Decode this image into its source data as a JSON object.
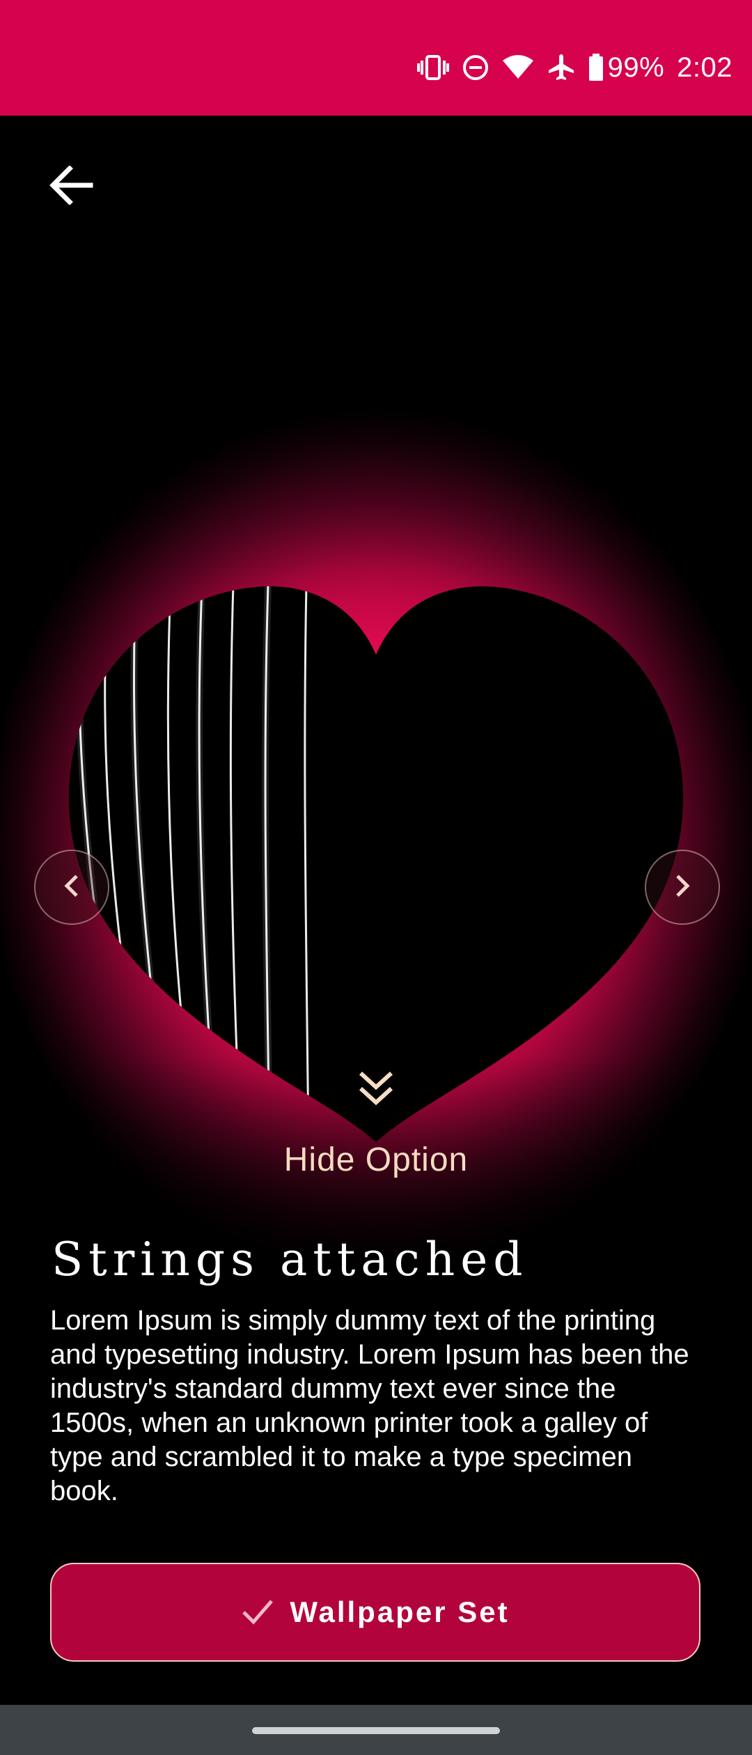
{
  "status_bar": {
    "battery_text": "99%",
    "time": "2:02",
    "background": "#d7024e",
    "icons": [
      "vibrate-icon",
      "do-not-disturb-icon",
      "wifi-icon",
      "airplane-mode-icon",
      "battery-icon"
    ]
  },
  "header": {
    "back_icon": "arrow-back-icon"
  },
  "preview": {
    "prev_icon": "chevron-left-icon",
    "next_icon": "chevron-right-icon",
    "hide_icon": "double-chevron-down-icon",
    "hide_label": "Hide Option",
    "glow_color": "#e3064f"
  },
  "content": {
    "title": "Strings attached",
    "description": "Lorem Ipsum is simply dummy text of the printing and typesetting industry. Lorem Ipsum has been the industry's standard dummy text ever since the 1500s, when an unknown printer took a galley of type and scrambled it to make a type specimen book."
  },
  "action": {
    "label": "Wallpaper Set",
    "icon": "check-icon",
    "background": "#b3033c"
  }
}
